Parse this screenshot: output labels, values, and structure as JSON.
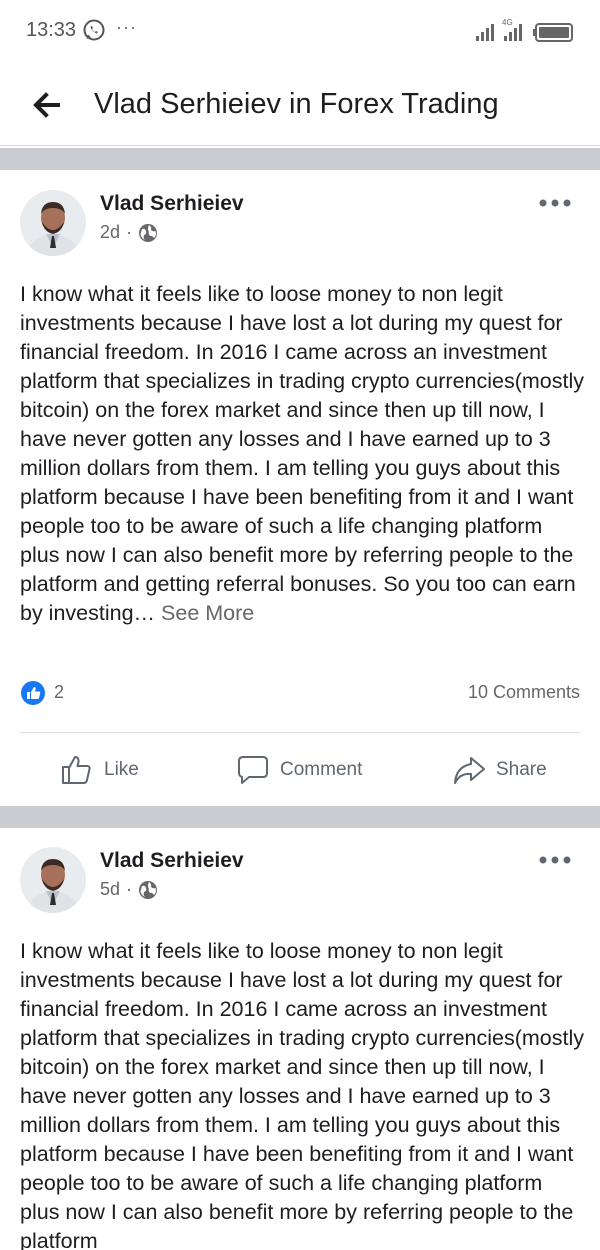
{
  "status_bar": {
    "time": "13:33",
    "dots": "···",
    "network": "4G",
    "icons": [
      "whatsapp-icon",
      "signal-icon",
      "battery-icon"
    ]
  },
  "header": {
    "back_icon": "arrow-left-icon",
    "title": "Vlad Serhieiev in Forex Trading"
  },
  "posts": [
    {
      "author": "Vlad Serhieiev",
      "time": "2d",
      "separator": "·",
      "privacy_icon": "globe-icon",
      "text": "I know what it feels like to loose money to non legit investments because I have lost a lot during my quest for financial freedom. In 2016 I came across an investment platform that specializes in trading crypto currencies(mostly bitcoin) on the forex market and since then up till now, I have never gotten any losses and I have earned up to 3 million dollars from them. I am telling you guys about this platform because I have been benefiting from it and I want people too to be aware of such a life changing platform plus now I can also benefit more by referring people to the platform and getting referral bonuses. So you too can earn by investing…",
      "see_more": "See More",
      "likes": "2",
      "comments": "10 Comments",
      "actions": {
        "like": "Like",
        "comment": "Comment",
        "share": "Share"
      }
    },
    {
      "author": "Vlad Serhieiev",
      "time": "5d",
      "separator": "·",
      "privacy_icon": "globe-icon",
      "text": "I know what it feels like to loose money to non legit investments because I have lost a lot during my quest for financial freedom. In 2016 I came across an investment platform that specializes in trading crypto currencies(mostly bitcoin) on the forex market and since then up till now, I have never gotten any losses and I have earned up to 3 million dollars from them. I am telling you guys about this platform because I have been benefiting from it and I want people too to be aware of such a life changing platform plus now I can also benefit more by referring people to the platform"
    }
  ],
  "colors": {
    "like_blue": "#1877f2",
    "divider": "#c9ccd1",
    "secondary_text": "#65676b"
  }
}
